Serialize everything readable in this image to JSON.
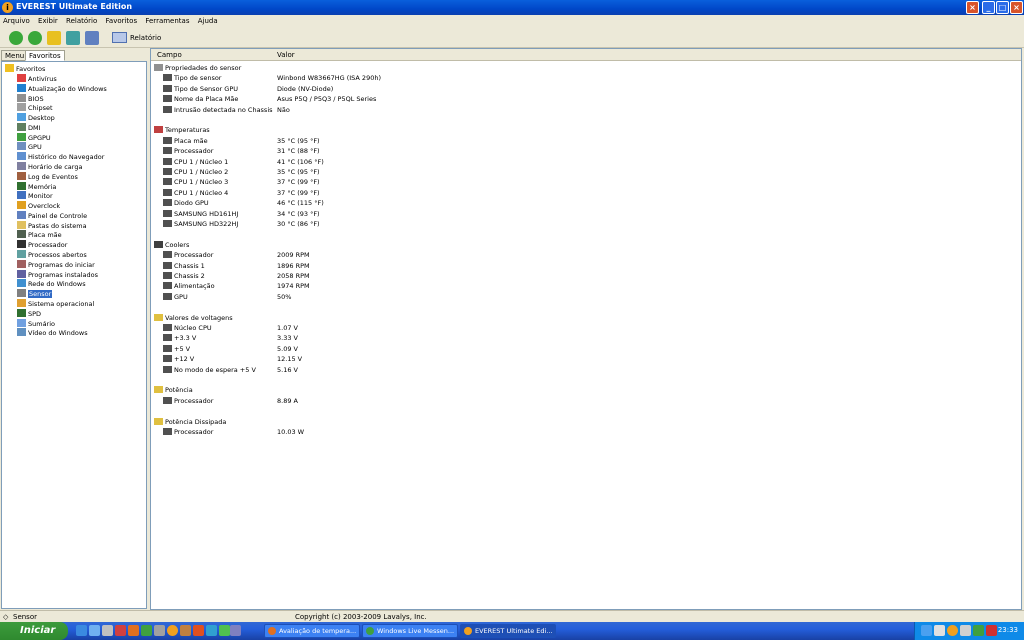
{
  "window": {
    "title": "EVEREST Ultimate Edition"
  },
  "menu": [
    "Arquivo",
    "Exibir",
    "Relatório",
    "Favoritos",
    "Ferramentas",
    "Ajuda"
  ],
  "toolbar": {
    "report_label": "Relatório"
  },
  "left_tabs": [
    "Menu",
    "Favoritos"
  ],
  "tree": {
    "root": "Favoritos",
    "items": [
      "Antivírus",
      "Atualização do Windows",
      "BIOS",
      "Chipset",
      "Desktop",
      "DMI",
      "GPGPU",
      "GPU",
      "Histórico do Navegador",
      "Horário de carga",
      "Log de Eventos",
      "Memória",
      "Monitor",
      "Overclock",
      "Painel de Controle",
      "Pastas do sistema",
      "Placa mãe",
      "Processador",
      "Processos abertos",
      "Programas do iniciar",
      "Programas instalados",
      "Rede do Windows",
      "Sensor",
      "Sistema operacional",
      "SPD",
      "Sumário",
      "Vídeo do Windows"
    ],
    "selected": "Sensor"
  },
  "columns": {
    "field": "Campo",
    "value": "Valor"
  },
  "groups": [
    {
      "title": "Propriedades do sensor",
      "rows": [
        {
          "field": "Tipo de sensor",
          "value": "Winbond W83667HG  (ISA 290h)"
        },
        {
          "field": "Tipo de Sensor GPU",
          "value": "Diode  (NV-Diode)"
        },
        {
          "field": "Nome da Placa Mãe",
          "value": "Asus P5Q / P5Q3 / P5QL Series"
        },
        {
          "field": "Intrusão detectada no Chassis",
          "value": "Não"
        }
      ]
    },
    {
      "title": "Temperaturas",
      "rows": [
        {
          "field": "Placa mãe",
          "value": "35 °C  (95 °F)"
        },
        {
          "field": "Processador",
          "value": "31 °C  (88 °F)"
        },
        {
          "field": "CPU 1 / Núcleo 1",
          "value": "41 °C  (106 °F)"
        },
        {
          "field": "CPU 1 / Núcleo 2",
          "value": "35 °C  (95 °F)"
        },
        {
          "field": "CPU 1 / Núcleo 3",
          "value": "37 °C  (99 °F)"
        },
        {
          "field": "CPU 1 / Núcleo 4",
          "value": "37 °C  (99 °F)"
        },
        {
          "field": "Diodo GPU",
          "value": "46 °C  (115 °F)"
        },
        {
          "field": "SAMSUNG HD161HJ",
          "value": "34 °C  (93 °F)"
        },
        {
          "field": "SAMSUNG HD322HJ",
          "value": "30 °C  (86 °F)"
        }
      ]
    },
    {
      "title": "Coolers",
      "rows": [
        {
          "field": "Processador",
          "value": "2009 RPM"
        },
        {
          "field": "Chassis 1",
          "value": "1896 RPM"
        },
        {
          "field": "Chassis 2",
          "value": "2058 RPM"
        },
        {
          "field": "Alimentação",
          "value": "1974 RPM"
        },
        {
          "field": "GPU",
          "value": "50%"
        }
      ]
    },
    {
      "title": "Valores de voltagens",
      "rows": [
        {
          "field": "Núcleo CPU",
          "value": "1.07 V"
        },
        {
          "field": "+3.3 V",
          "value": "3.33 V"
        },
        {
          "field": "+5 V",
          "value": "5.09 V"
        },
        {
          "field": "+12 V",
          "value": "12.15 V"
        },
        {
          "field": "No modo de espera +5 V",
          "value": "5.16 V"
        }
      ]
    },
    {
      "title": "Potência",
      "rows": [
        {
          "field": "Processador",
          "value": "8.89 A"
        }
      ]
    },
    {
      "title": "Potência Dissipada",
      "rows": [
        {
          "field": "Processador",
          "value": "10.03 W"
        }
      ]
    }
  ],
  "status": {
    "left": "Sensor",
    "center": "Copyright (c) 2003-2009 Lavalys, Inc."
  },
  "taskbar": {
    "start": "Iniciar",
    "tasks": [
      "Avaliação de tempera...",
      "Windows Live Messen...",
      "EVEREST Ultimate Edi..."
    ],
    "clock": "23:33"
  }
}
